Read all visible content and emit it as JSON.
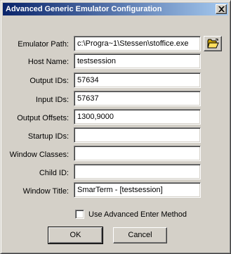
{
  "window": {
    "title": "Advanced Generic Emulator Configuration"
  },
  "fields": [
    {
      "label": "Emulator Path:",
      "value": "c:\\Progra~1\\Stessen\\stoffice.exe"
    },
    {
      "label": "Host Name:",
      "value": "testsession"
    },
    {
      "label": "Output IDs:",
      "value": "57634"
    },
    {
      "label": "Input IDs:",
      "value": "57637"
    },
    {
      "label": "Output Offsets:",
      "value": "1300,9000"
    },
    {
      "label": "Startup IDs:",
      "value": ""
    },
    {
      "label": "Window Classes:",
      "value": ""
    },
    {
      "label": "Child ID:",
      "value": ""
    },
    {
      "label": "Window Title:",
      "value": "SmarTerm - [testsession]"
    }
  ],
  "checkbox": {
    "label": "Use Advanced Enter Method",
    "checked": false
  },
  "buttons": {
    "ok": "OK",
    "cancel": "Cancel"
  },
  "icons": {
    "browse": "open-folder-icon",
    "close": "close-icon"
  }
}
